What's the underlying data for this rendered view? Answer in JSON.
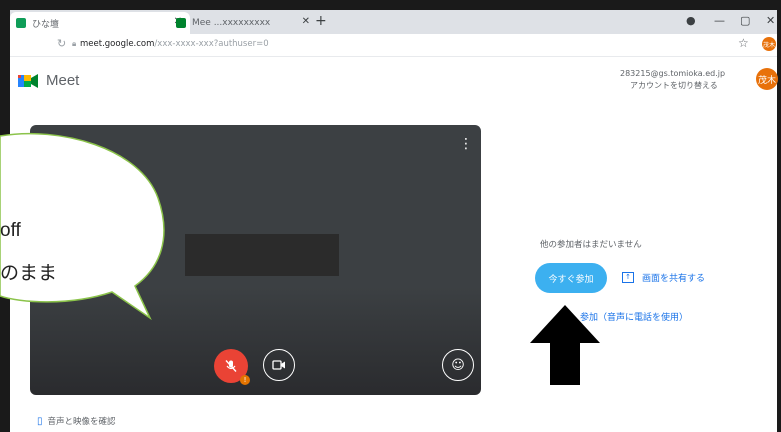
{
  "browser": {
    "tabs": [
      {
        "title": "ひな壇",
        "active": true
      },
      {
        "title": "Mee ...xxxxxxxxx",
        "active": false
      }
    ],
    "new_tab": "+",
    "url_host": "meet.google.com",
    "url_path": "/xxx-xxxx-xxx?authuser=0",
    "profile_initials": "茂木"
  },
  "header": {
    "app_name": "Meet",
    "account_line1": "283215@gs.tomioka.ed.jp",
    "account_line2": "アカウントを切り替える",
    "avatar_label": "茂木"
  },
  "preview": {
    "mic_state": "off",
    "camera_state": "on"
  },
  "join_panel": {
    "no_one_text": "他の参加者はまだいません",
    "join_button": "今すぐ参加",
    "present_link": "画面を共有する",
    "phone_link": "参加（音声に電話を使用）"
  },
  "footer": {
    "audio_check": "音声と映像を確認"
  },
  "callout": {
    "line1": "off",
    "line2": "のまま"
  },
  "colors": {
    "accent": "#1a73e8",
    "join_button": "#3cb0f0",
    "mic_off": "#ea4335",
    "avatar": "#e8710a",
    "bubble_fill": "#ffffff",
    "bubble_stroke": "#8bc34a"
  }
}
